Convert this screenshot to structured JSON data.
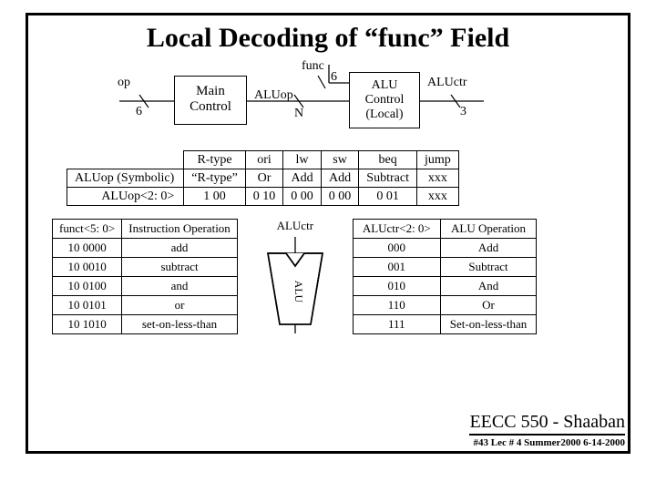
{
  "title": "Local Decoding of “func” Field",
  "diagram": {
    "op": "op",
    "op_w": "6",
    "main": "Main\nControl",
    "func": "func",
    "func_w": "6",
    "aluop": "ALUop",
    "aluop_w": "N",
    "alu_local": "ALU\nControl\n(Local)",
    "aluctr": "ALUctr",
    "aluctr_w": "3"
  },
  "t1": {
    "cols": [
      "R-type",
      "ori",
      "lw",
      "sw",
      "beq",
      "jump"
    ],
    "rows": [
      {
        "h": "ALUop (Symbolic)",
        "c": [
          "“R-type”",
          "Or",
          "Add",
          "Add",
          "Subtract",
          "xxx"
        ]
      },
      {
        "h": "ALUop<2: 0>",
        "c": [
          "1 00",
          "0 10",
          "0 00",
          "0 00",
          "0 01",
          "xxx"
        ]
      }
    ]
  },
  "t2": {
    "head": [
      "funct<5: 0>",
      "Instruction Operation"
    ],
    "rows": [
      [
        "10 0000",
        "add"
      ],
      [
        "10 0010",
        "subtract"
      ],
      [
        "10 0100",
        "and"
      ],
      [
        "10 0101",
        "or"
      ],
      [
        "10 1010",
        "set-on-less-than"
      ]
    ]
  },
  "alu_label": "ALUctr",
  "alu_inner": "ALU",
  "t3": {
    "head": [
      "ALUctr<2: 0>",
      "ALU Operation"
    ],
    "rows": [
      [
        "000",
        "Add"
      ],
      [
        "001",
        "Subtract"
      ],
      [
        "010",
        "And"
      ],
      [
        "110",
        "Or"
      ],
      [
        "111",
        "Set-on-less-than"
      ]
    ]
  },
  "footer": {
    "course": "EECC 550 - Shaaban",
    "meta": "#43  Lec # 4    Summer2000    6-14-2000"
  }
}
